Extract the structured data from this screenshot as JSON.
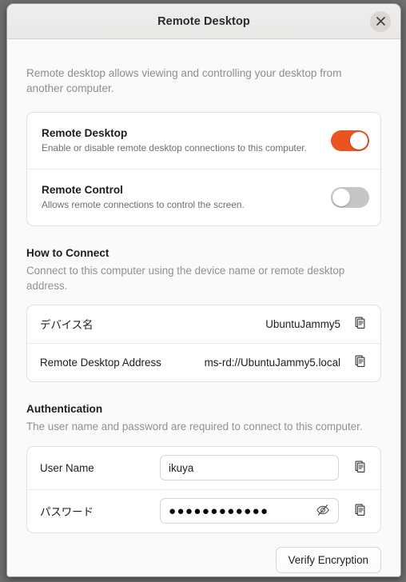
{
  "window": {
    "title": "Remote Desktop",
    "close_icon": "close-icon",
    "close_label": "Close"
  },
  "intro": "Remote desktop allows viewing and controlling your desktop from another computer.",
  "toggles": [
    {
      "title": "Remote Desktop",
      "subtitle": "Enable or disable remote desktop connections to this computer.",
      "state": "on",
      "state_label": "On"
    },
    {
      "title": "Remote Control",
      "subtitle": "Allows remote connections to control the screen.",
      "state": "off",
      "state_label": "Off"
    }
  ],
  "how_to_connect": {
    "heading": "How to Connect",
    "description": "Connect to this computer using the device name or remote desktop address.",
    "rows": [
      {
        "label": "デバイス名",
        "value": "UbuntuJammy5",
        "copy_icon": "copy-icon"
      },
      {
        "label": "Remote Desktop Address",
        "value": "ms-rd://UbuntuJammy5.local",
        "copy_icon": "copy-icon"
      }
    ]
  },
  "authentication": {
    "heading": "Authentication",
    "description": "The user name and password are required to connect to this computer.",
    "user_name": {
      "label": "User Name",
      "value": "ikuya",
      "placeholder": "",
      "copy_icon": "copy-icon"
    },
    "password": {
      "label": "パスワード",
      "masked_value": "●●●●●●●●●●●●",
      "dot_count": 12,
      "reveal_icon": "eye-slash-icon",
      "copy_icon": "copy-icon"
    }
  },
  "footer": {
    "verify_label": "Verify Encryption"
  },
  "colors": {
    "accent": "#e95420",
    "toggle_off": "#c8c6c4",
    "window_bg": "#fafafa",
    "card_bg": "#ffffff",
    "title_text": "#2b2b2b",
    "muted_text": "#8e8e8e"
  }
}
